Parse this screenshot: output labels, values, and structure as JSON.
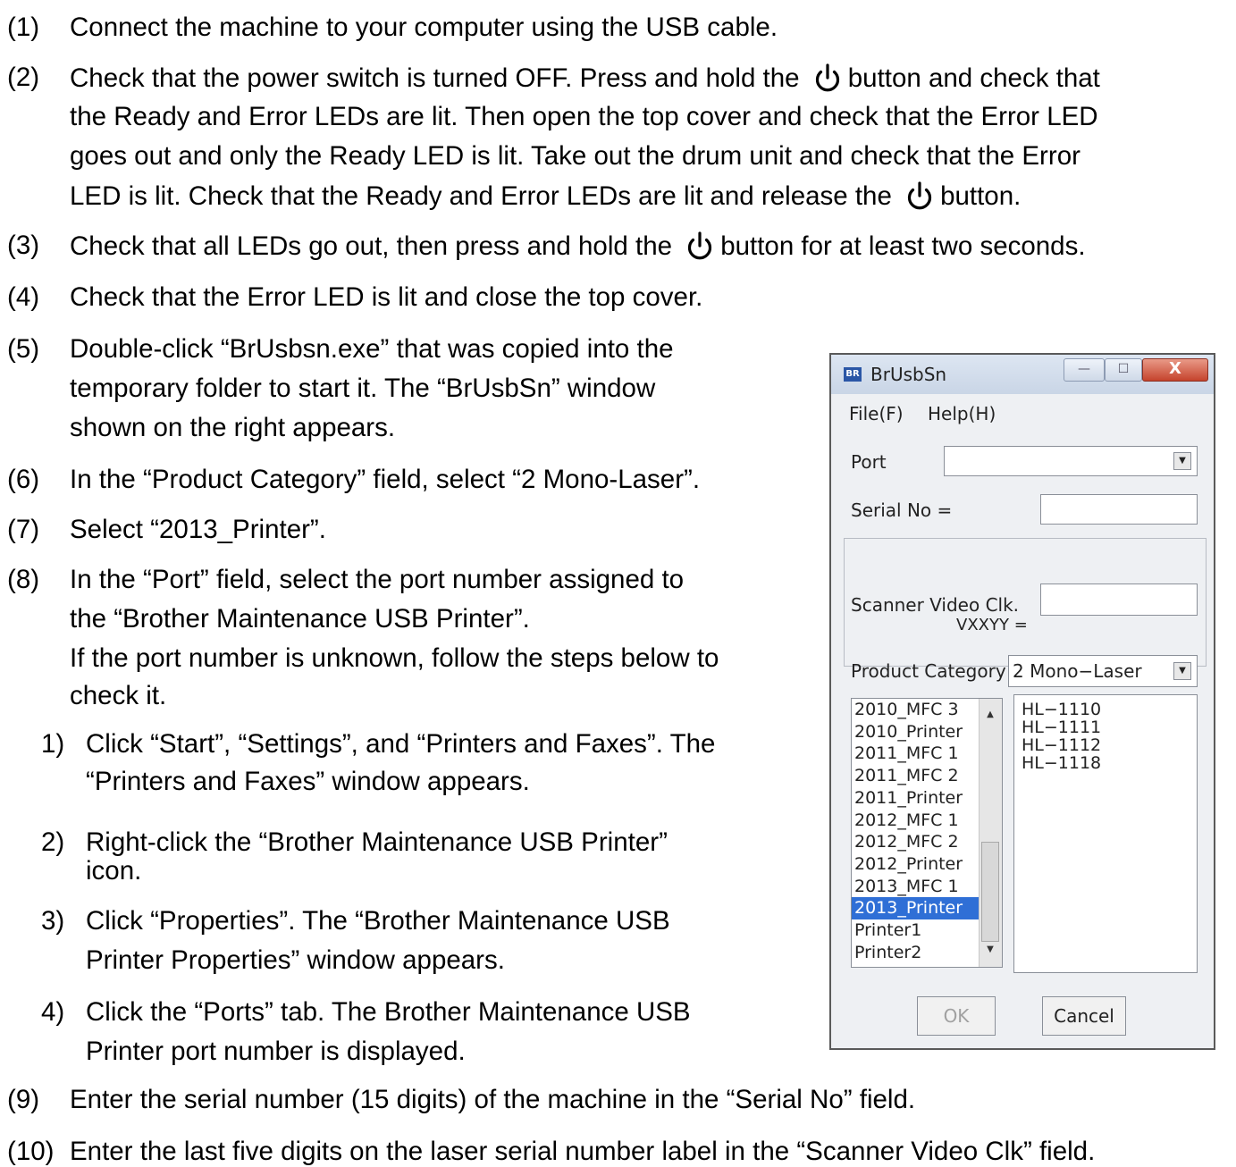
{
  "steps": [
    {
      "num": "(1)",
      "lines": [
        "Connect the machine to your computer using the USB cable."
      ]
    },
    {
      "num": "(2)",
      "lines": [
        [
          "Check that the power switch is turned OFF. Press and hold the ",
          "button and check that"
        ],
        "the Ready and Error LEDs are lit. Then open the top cover and check that the Error LED",
        "goes out and only the Ready LED is lit. Take out the drum unit and check that the Error",
        [
          "LED is lit. Check that the Ready and Error LEDs are lit and release the ",
          "button."
        ]
      ]
    },
    {
      "num": "(3)",
      "lines": [
        [
          "Check that all LEDs go out, then press and hold the ",
          "button for at least two seconds."
        ]
      ]
    },
    {
      "num": "(4)",
      "lines": [
        "Check that the Error LED is lit and close the top cover."
      ]
    },
    {
      "num": "(5)",
      "lines": [
        "Double-click “BrUsbsn.exe” that was copied into the",
        "temporary folder to start it. The “BrUsbSn” window",
        "shown on the right appears."
      ]
    },
    {
      "num": "(6)",
      "lines": [
        "In the “Product Category” field, select “2 Mono-Laser”."
      ]
    },
    {
      "num": "(7)",
      "lines": [
        "Select “2013_Printer”."
      ]
    },
    {
      "num": "(8)",
      "lines": [
        "In the “Port” field, select the port number assigned to",
        "the “Brother Maintenance USB Printer”.",
        "If the port number is unknown, follow the steps below to",
        "check it."
      ]
    },
    {
      "num": "(9)",
      "lines": [
        "Enter the serial number (15 digits) of the machine in the “Serial No” field."
      ]
    },
    {
      "num": "(10)",
      "lines": [
        "Enter the last five digits on the laser serial number label in the “Scanner Video Clk” field."
      ]
    }
  ],
  "substeps": [
    {
      "num": "1)",
      "lines": [
        "Click “Start”, “Settings”, and “Printers and Faxes”. The",
        "“Printers and Faxes” window appears."
      ]
    },
    {
      "num": "2)",
      "lines": [
        "Right-click the “Brother Maintenance USB Printer”",
        "icon."
      ]
    },
    {
      "num": "3)",
      "lines": [
        "Click “Properties”. The “Brother Maintenance USB",
        "Printer Properties” window appears."
      ]
    },
    {
      "num": "4)",
      "lines": [
        "Click the “Ports” tab. The Brother Maintenance USB",
        "Printer port number is displayed."
      ]
    }
  ],
  "dialog": {
    "title": "BrUsbSn",
    "icon_text": "BR",
    "window_controls": {
      "minimize": "—",
      "maximize": "☐",
      "close": "X"
    },
    "menu": [
      "File(F)",
      "Help(H)"
    ],
    "port_label": "Port",
    "port_value": "",
    "serial_label": "Serial No =",
    "serial_value": "",
    "scanner_label_1": "Scanner Video Clk.",
    "scanner_label_2": "VXXYY =",
    "scanner_value": "",
    "category_label": "Product Category",
    "category_value": "2 Mono−Laser",
    "models": [
      "2010_MFC 3",
      "2010_Printer",
      "2011_MFC 1",
      "2011_MFC 2",
      "2011_Printer",
      "2012_MFC 1",
      "2012_MFC 2",
      "2012_Printer",
      "2013_MFC 1",
      "2013_Printer",
      "Printer1",
      "Printer2"
    ],
    "selected_model": "2013_Printer",
    "products": [
      "HL−1110",
      "HL−1111",
      "HL−1112",
      "HL−1118"
    ],
    "ok_label": "OK",
    "cancel_label": "Cancel",
    "power_icon": "power-button-icon"
  }
}
